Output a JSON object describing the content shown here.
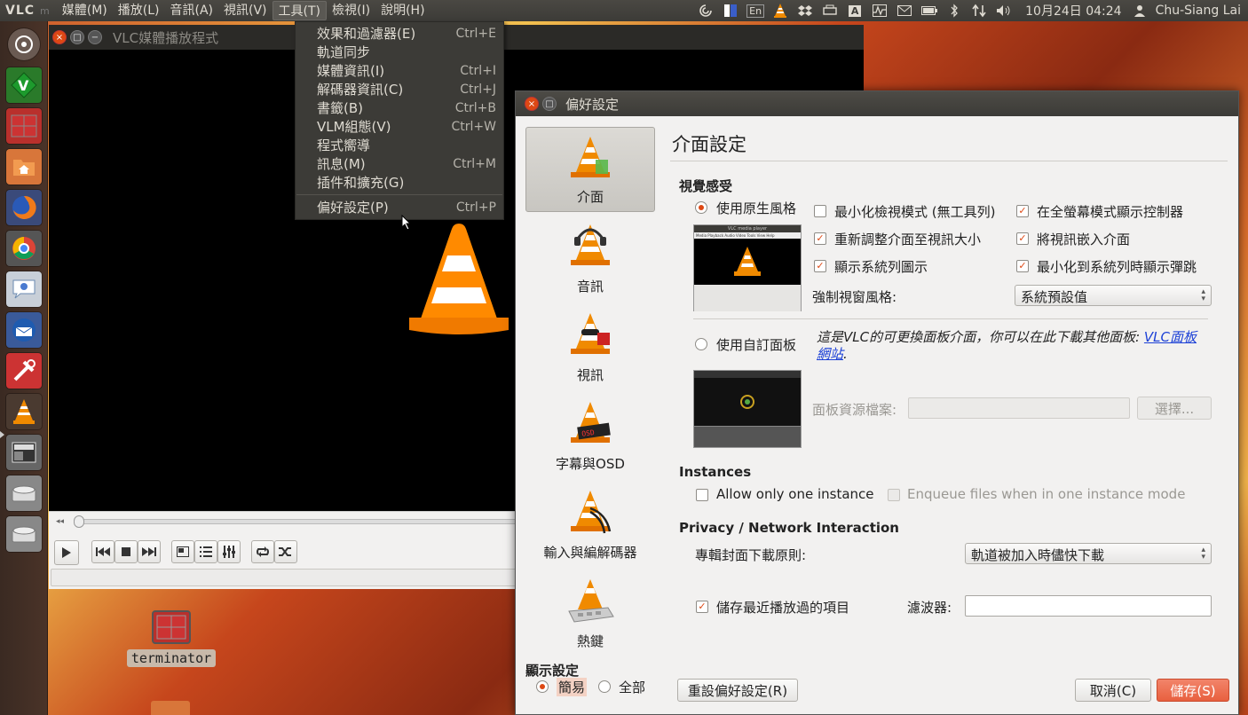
{
  "topbar": {
    "app_name": "VLC",
    "menu_sep": "m",
    "menus": [
      "媒體(M)",
      "播放(L)",
      "音訊(A)",
      "視訊(V)",
      "工具(T)",
      "檢視(I)",
      "說明(H)"
    ],
    "active_menu": "工具(T)",
    "tray_kb": "En",
    "tray_a": "A",
    "clock": "10月24日 04:24",
    "user": "Chu-Siang Lai"
  },
  "vlc_main": {
    "title": "VLC媒體播放程式"
  },
  "tools_menu": {
    "items": [
      {
        "label": "效果和過濾器(E)",
        "shortcut": "Ctrl+E"
      },
      {
        "label": "軌道同步",
        "shortcut": ""
      },
      {
        "label": "媒體資訊(I)",
        "shortcut": "Ctrl+I"
      },
      {
        "label": "解碼器資訊(C)",
        "shortcut": "Ctrl+J"
      },
      {
        "label": "書籤(B)",
        "shortcut": "Ctrl+B"
      },
      {
        "label": "VLM組態(V)",
        "shortcut": "Ctrl+W"
      },
      {
        "label": "程式嚮導",
        "shortcut": ""
      },
      {
        "label": "訊息(M)",
        "shortcut": "Ctrl+M"
      },
      {
        "label": "插件和擴充(G)",
        "shortcut": ""
      }
    ],
    "prefs_item": {
      "label": "偏好設定(P)",
      "shortcut": "Ctrl+P"
    }
  },
  "desktop": {
    "terminator_label": "terminator"
  },
  "prefs": {
    "title": "偏好設定",
    "categories": [
      "介面",
      "音訊",
      "視訊",
      "字幕與OSD",
      "輸入與編解碼器",
      "熱鍵"
    ],
    "selected_category": "介面",
    "heading": "介面設定",
    "look_section": "視覺感受",
    "native_style": "使用原生風格",
    "native_options": {
      "minimal_view": "最小化檢視模式 (無工具列)",
      "fullscreen_controller": "在全螢幕模式顯示控制器",
      "resize_interface": "重新調整介面至視訊大小",
      "embed_video": "將視訊嵌入介面",
      "systray_icon": "顯示系統列圖示",
      "systray_popup": "最小化到系統列時顯示彈跳"
    },
    "force_style_label": "強制視窗風格:",
    "force_style_value": "系統預設值",
    "custom_skin": "使用自訂面板",
    "skin_desc_prefix": "這是VLC的可更換面板介面，你可以在此下載其他面板: ",
    "skin_desc_link": "VLC面板網站",
    "skin_desc_suffix": ".",
    "skin_file_label": "面板資源檔案:",
    "skin_file_value": "",
    "choose_button": "選擇...",
    "instances_section": "Instances",
    "one_instance": "Allow only one instance",
    "enqueue": "Enqueue files when in one instance mode",
    "privacy_section": "Privacy / Network Interaction",
    "art_policy_label": "專輯封面下載原則:",
    "art_policy_value": "軌道被加入時儘快下載",
    "save_recent": "儲存最近播放過的項目",
    "filter_label": "濾波器:",
    "filter_value": "",
    "show_settings": "顯示設定",
    "simple": "簡易",
    "all": "全部",
    "reset_button": "重設偏好設定(R)",
    "cancel_button": "取消(C)",
    "save_button": "儲存(S)",
    "thumb_title": "VLC media player",
    "thumb_menus": "Media Playback Audio Video Tools View Help"
  },
  "colors": {
    "accent": "#dd4814",
    "panel": "#3c3b37",
    "dialog_bg": "#f2f1f0",
    "link": "#1a3fd6"
  }
}
